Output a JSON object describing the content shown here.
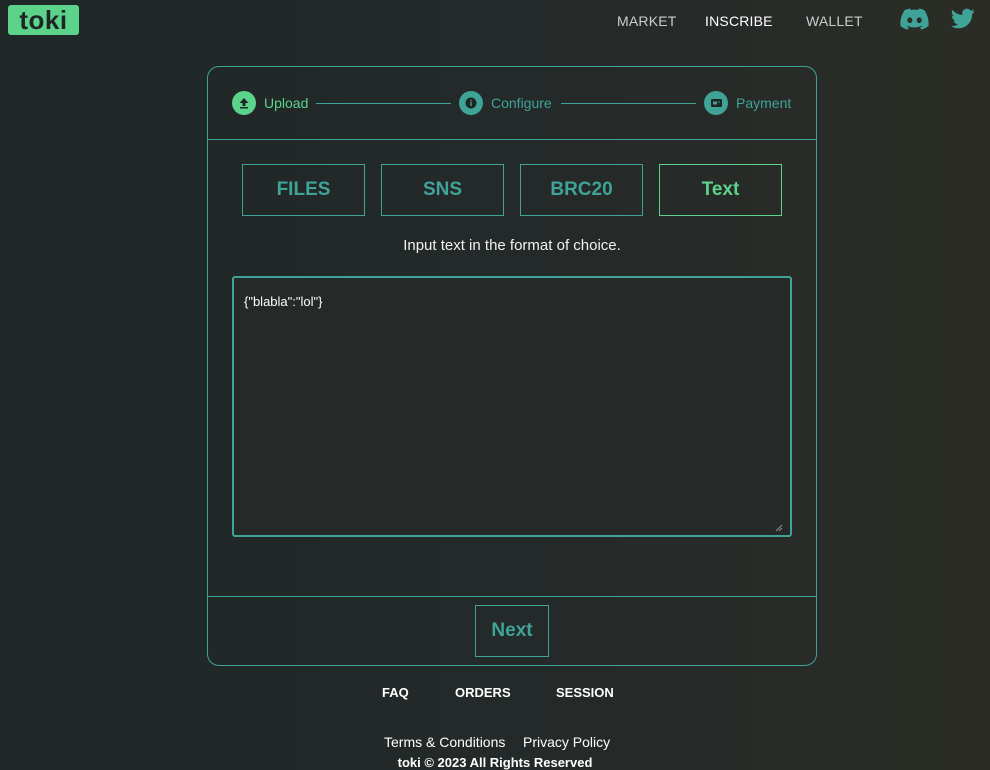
{
  "brand": {
    "name": "toki"
  },
  "nav": {
    "items": [
      {
        "label": "MARKET"
      },
      {
        "label": "INSCRIBE"
      },
      {
        "label": "WALLET"
      }
    ],
    "social": [
      "discord-icon",
      "twitter-icon"
    ]
  },
  "steps": [
    {
      "label": "Upload",
      "icon": "upload-icon",
      "state": "active"
    },
    {
      "label": "Configure",
      "icon": "info-icon",
      "state": "pending"
    },
    {
      "label": "Payment",
      "icon": "payment-icon",
      "state": "pending"
    }
  ],
  "tabs": [
    {
      "label": "FILES"
    },
    {
      "label": "SNS"
    },
    {
      "label": "BRC20"
    },
    {
      "label": "Text",
      "selected": true
    }
  ],
  "instruction": "Input text in the format of choice.",
  "editor": {
    "value": "{\"blabla\":\"lol\"}"
  },
  "next_button": {
    "label": "Next"
  },
  "footer": {
    "links": [
      {
        "label": "FAQ"
      },
      {
        "label": "ORDERS"
      },
      {
        "label": "SESSION"
      }
    ],
    "legal": [
      {
        "label": "Terms & Conditions"
      },
      {
        "label": "Privacy Policy"
      }
    ],
    "copyright": "toki © 2023 All Rights Reserved"
  },
  "colors": {
    "accent": "#5bd38b",
    "teal": "#3fa398",
    "background": "#252a29"
  }
}
